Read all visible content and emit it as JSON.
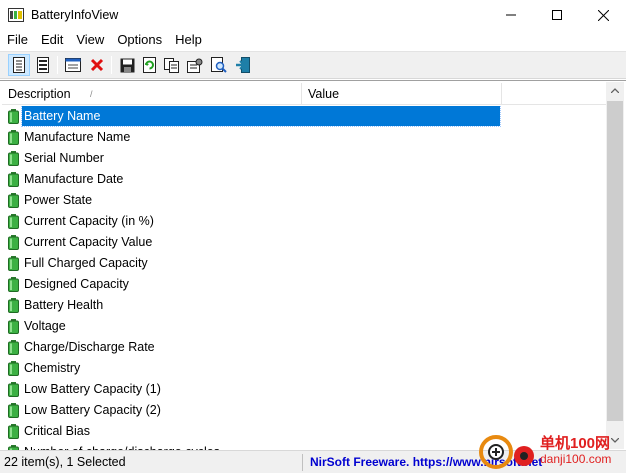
{
  "window": {
    "title": "BatteryInfoView"
  },
  "menu": [
    "File",
    "Edit",
    "View",
    "Options",
    "Help"
  ],
  "toolbar": {
    "buttons": [
      "properties-view-icon",
      "list-view-icon",
      "html-report-icon",
      "delete-icon",
      "save-icon",
      "refresh-icon",
      "copy-icon",
      "properties-icon",
      "find-icon",
      "exit-icon"
    ]
  },
  "list": {
    "columns": [
      "Description",
      "Value"
    ],
    "rows": [
      "Battery Name",
      "Manufacture Name",
      "Serial Number",
      "Manufacture Date",
      "Power State",
      "Current Capacity (in %)",
      "Current Capacity Value",
      "Full Charged Capacity",
      "Designed Capacity",
      "Battery Health",
      "Voltage",
      "Charge/Discharge Rate",
      "Chemistry",
      "Low Battery Capacity (1)",
      "Low Battery Capacity (2)",
      "Critical Bias",
      "Number of charge/discharge cycles"
    ],
    "selected_index": 0
  },
  "status": {
    "items": "22 item(s), 1 Selected",
    "credit": "NirSoft Freeware. https://www.nirsoft.net"
  },
  "watermark": {
    "line1": "单机100网",
    "line2": "danji100.com"
  },
  "colors": {
    "selection": "#0078d7",
    "battery": "#3cb043",
    "link": "#0000d0"
  }
}
